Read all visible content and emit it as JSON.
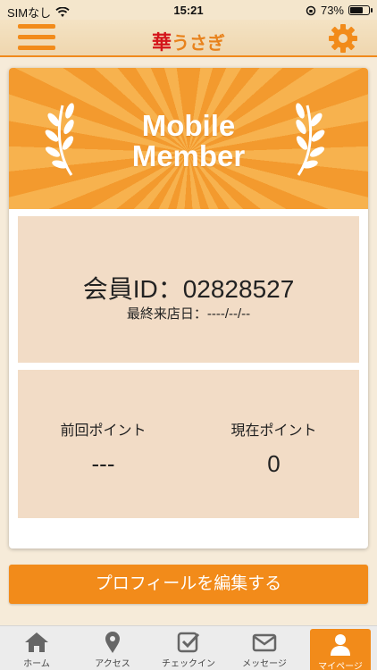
{
  "status_bar": {
    "carrier": "SIMなし",
    "time": "15:21",
    "battery_percent": "73%",
    "battery_level": 0.73
  },
  "header": {
    "logo_kanji": "華",
    "logo_kana": "うさぎ",
    "menu_icon": "hamburger-icon",
    "settings_icon": "gear-icon"
  },
  "banner": {
    "title_line1": "Mobile",
    "title_line2": "Member"
  },
  "member": {
    "id_label": "会員ID：02828527",
    "last_visit_label": "最終来店日：----/--/--"
  },
  "points": {
    "previous_label": "前回ポイント",
    "previous_value": "---",
    "current_label": "現在ポイント",
    "current_value": "0"
  },
  "edit_profile_label": "プロフィールを編集する",
  "tabs": [
    {
      "label": "ホーム",
      "icon": "home-icon"
    },
    {
      "label": "アクセス",
      "icon": "map-pin-icon"
    },
    {
      "label": "チェックイン",
      "icon": "checkin-icon"
    },
    {
      "label": "メッセージ",
      "icon": "envelope-icon"
    },
    {
      "label": "マイページ",
      "icon": "user-icon",
      "active": true
    }
  ],
  "colors": {
    "accent": "#f28b1a",
    "panel": "#f2dcc6",
    "background": "#f6ebd9"
  }
}
